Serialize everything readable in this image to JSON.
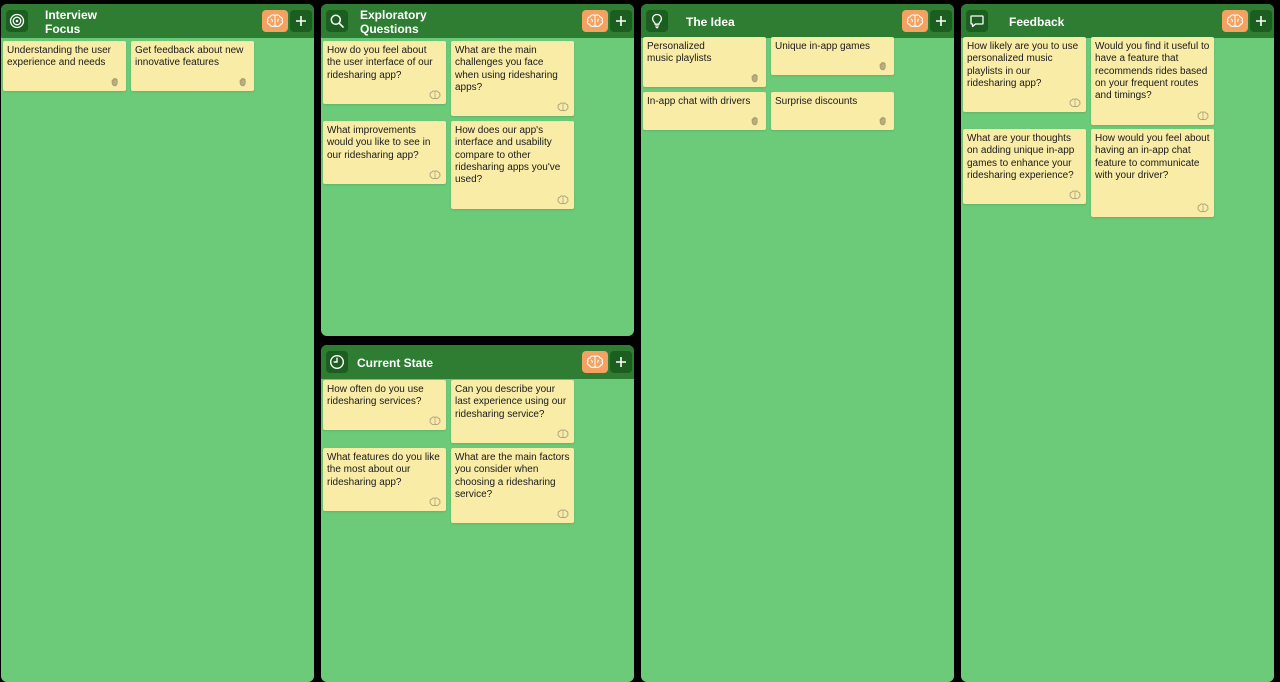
{
  "colors": {
    "background": "#000000",
    "panel": "#6ccb78",
    "header": "#2e7d32",
    "icon_box": "#1b5e20",
    "brain_button": "#f4a261",
    "note": "#f8eca7"
  },
  "panels": [
    {
      "title": "Interview\nFocus",
      "icon": "target-icon",
      "notes": [
        {
          "text": "Understanding the user experience and needs",
          "icon": "hand-icon"
        },
        {
          "text": "Get feedback about new innovative features",
          "icon": "hand-icon"
        }
      ]
    },
    {
      "title": "Exploratory\nQuestions",
      "icon": "search-icon",
      "notes": [
        {
          "text": "How do you feel about the user interface of our ridesharing app?",
          "icon": "brain-icon"
        },
        {
          "text": "What are the main challenges you face when using ridesharing apps?",
          "icon": "brain-icon"
        },
        {
          "text": "What improvements would you like to see in our ridesharing app?",
          "icon": "brain-icon"
        },
        {
          "text": "How does our app's interface and usability compare to other ridesharing apps you've used?",
          "icon": "brain-icon"
        }
      ]
    },
    {
      "title": "Current State",
      "icon": "clock-icon",
      "notes": [
        {
          "text": "How often do you use ridesharing services?",
          "icon": "brain-icon"
        },
        {
          "text": "Can you describe your last experience using our ridesharing service?",
          "icon": "brain-icon"
        },
        {
          "text": "What features do you like the most about our ridesharing app?",
          "icon": "brain-icon"
        },
        {
          "text": "What are the main factors you consider when choosing a ridesharing service?",
          "icon": "brain-icon"
        }
      ]
    },
    {
      "title": "The Idea",
      "icon": "lightbulb-icon",
      "notes": [
        {
          "text": "Personalized music playlists",
          "icon": "hand-icon"
        },
        {
          "text": "Unique in-app games",
          "icon": "hand-icon"
        },
        {
          "text": "In-app chat with drivers",
          "icon": "hand-icon"
        },
        {
          "text": "Surprise discounts",
          "icon": "hand-icon"
        }
      ]
    },
    {
      "title": "Feedback",
      "icon": "speech-bubble-icon",
      "notes": [
        {
          "text": "How likely are you to use personalized music playlists in our ridesharing app?",
          "icon": "brain-icon"
        },
        {
          "text": "Would you find it useful to have a feature that recommends rides based on your frequent routes and timings?",
          "icon": "brain-icon"
        },
        {
          "text": "What are your thoughts on adding unique in-app games to enhance your ridesharing experience?",
          "icon": "brain-icon"
        },
        {
          "text": "How would you feel about having an in-app chat feature to communicate with your driver?",
          "icon": "brain-icon"
        }
      ]
    }
  ]
}
